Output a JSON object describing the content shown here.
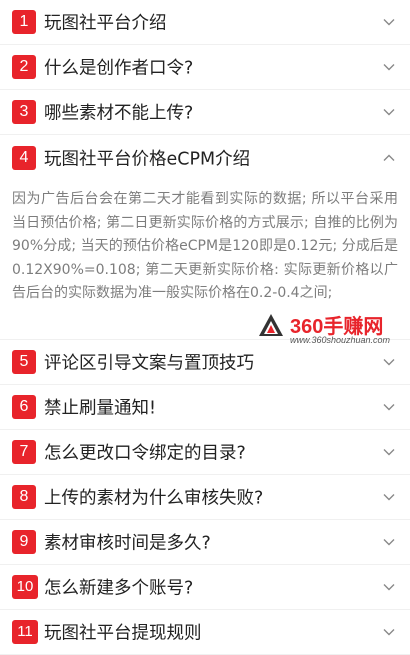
{
  "colors": {
    "badge": "#e8242b",
    "title_text": "#222222",
    "answer_text": "#7d7d7d",
    "chevron": "#888888"
  },
  "faq": [
    {
      "number": "1",
      "title": "玩图社平台介绍",
      "expanded": false
    },
    {
      "number": "2",
      "title": "什么是创作者口令?",
      "expanded": false
    },
    {
      "number": "3",
      "title": "哪些素材不能上传?",
      "expanded": false
    },
    {
      "number": "4",
      "title": "玩图社平台价格eCPM介绍",
      "expanded": true,
      "answer": "因为广告后台会在第二天才能看到实际的数据; 所以平台采用当日预估价格; 第二日更新实际价格的方式展示; 自推的比例为90%分成; 当天的预估价格eCPM是120即是0.12元; 分成后是0.12X90%=0.108; 第二天更新实际价格: 实际更新价格以广告后台的实际数据为准一般实际价格在0.2-0.4之间;"
    },
    {
      "number": "5",
      "title": "评论区引导文案与置顶技巧",
      "expanded": false
    },
    {
      "number": "6",
      "title": "禁止刷量通知!",
      "expanded": false
    },
    {
      "number": "7",
      "title": "怎么更改口令绑定的目录?",
      "expanded": false
    },
    {
      "number": "8",
      "title": "上传的素材为什么审核失败?",
      "expanded": false
    },
    {
      "number": "9",
      "title": "素材审核时间是多久?",
      "expanded": false
    },
    {
      "number": "10",
      "title": "怎么新建多个账号?",
      "expanded": false
    },
    {
      "number": "11",
      "title": "玩图社平台提现规则",
      "expanded": false
    }
  ],
  "watermark": {
    "name": "360手赚网",
    "url": "www.360shouzhuan.com"
  }
}
